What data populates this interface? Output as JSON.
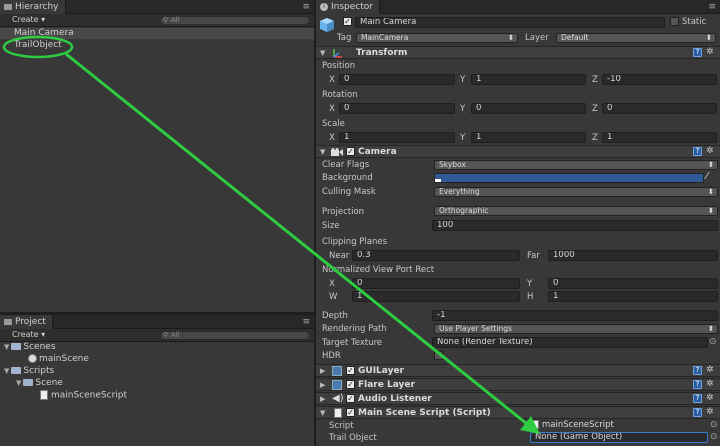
{
  "hierarchy": {
    "tab_label": "Hierarchy",
    "create_label": "Create",
    "search_placeholder": "All",
    "items": [
      "Main Camera",
      "TrailObject"
    ]
  },
  "project": {
    "tab_label": "Project",
    "create_label": "Create",
    "search_placeholder": "All",
    "tree": {
      "scenes_folder": "Scenes",
      "scene_file": "mainScene",
      "scripts_folder": "Scripts",
      "scripts_scene_folder": "Scene",
      "script_file": "mainSceneScript"
    }
  },
  "inspector": {
    "tab_label": "Inspector",
    "object_name": "Main Camera",
    "static_label": "Static",
    "tag_label": "Tag",
    "tag_value": "MainCamera",
    "layer_label": "Layer",
    "layer_value": "Default",
    "transform": {
      "title": "Transform",
      "position_label": "Position",
      "rotation_label": "Rotation",
      "scale_label": "Scale",
      "x_label": "X",
      "y_label": "Y",
      "z_label": "Z",
      "position": [
        "0",
        "1",
        "-10"
      ],
      "rotation": [
        "0",
        "0",
        "0"
      ],
      "scale": [
        "1",
        "1",
        "1"
      ]
    },
    "camera": {
      "title": "Camera",
      "clear_flags_label": "Clear Flags",
      "clear_flags_value": "Skybox",
      "background_label": "Background",
      "background_color": "#2f5a96",
      "culling_mask_label": "Culling Mask",
      "culling_mask_value": "Everything",
      "projection_label": "Projection",
      "projection_value": "Orthographic",
      "size_label": "Size",
      "size_value": "100",
      "clipping_label": "Clipping Planes",
      "near_label": "Near",
      "near_value": "0.3",
      "far_label": "Far",
      "far_value": "1000",
      "viewport_label": "Normalized View Port Rect",
      "vx_label": "X",
      "vx_value": "0",
      "vy_label": "Y",
      "vy_value": "0",
      "vw_label": "W",
      "vw_value": "1",
      "vh_label": "H",
      "vh_value": "1",
      "depth_label": "Depth",
      "depth_value": "-1",
      "rendering_path_label": "Rendering Path",
      "rendering_path_value": "Use Player Settings",
      "target_texture_label": "Target Texture",
      "target_texture_value": "None (Render Texture)",
      "hdr_label": "HDR"
    },
    "components": [
      "GUILayer",
      "Flare Layer",
      "Audio Listener",
      "Main Scene Script (Script)"
    ],
    "script_comp": {
      "script_label": "Script",
      "script_value": "mainSceneScript",
      "trail_label": "Trail Object",
      "trail_value": "None (Game Object)"
    }
  },
  "annotation": {
    "arrow_color": "#2ecc40",
    "circle_color": "#2ecc40"
  }
}
